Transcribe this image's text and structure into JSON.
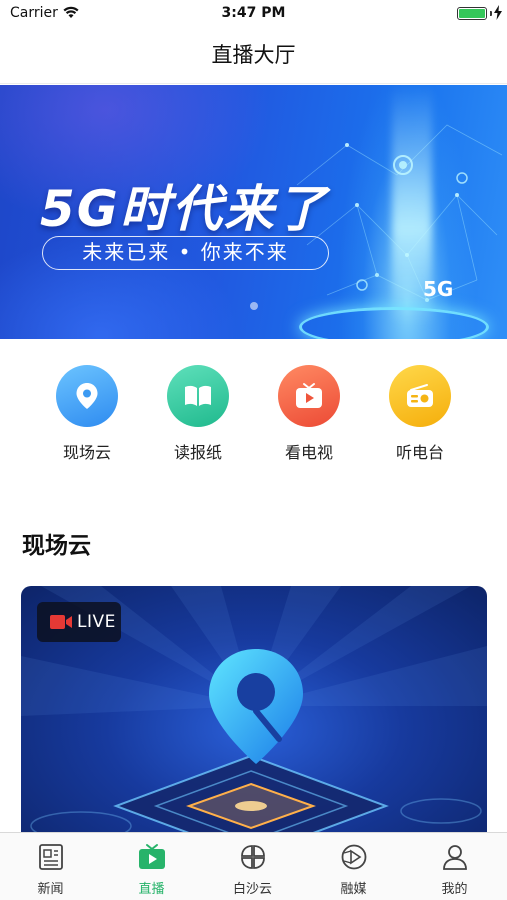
{
  "status_bar": {
    "carrier": "Carrier",
    "time": "3:47 PM",
    "battery_level": 1.0
  },
  "nav": {
    "title": "直播大厅"
  },
  "banner": {
    "headline": "5G时代来了",
    "subtitle": "未来已来 • 你来不来",
    "badge": "5G"
  },
  "quick_links": [
    {
      "label": "现场云",
      "icon": "location-pin-icon",
      "color": "#4aa8f5"
    },
    {
      "label": "读报纸",
      "icon": "book-icon",
      "color": "#33cfa3"
    },
    {
      "label": "看电视",
      "icon": "tv-play-icon",
      "color": "#f4664a"
    },
    {
      "label": "听电台",
      "icon": "radio-icon",
      "color": "#f7c21e"
    }
  ],
  "section": {
    "title": "现场云"
  },
  "live_card": {
    "badge": "LIVE"
  },
  "tabs": [
    {
      "label": "新闻",
      "icon": "news-icon",
      "active": false
    },
    {
      "label": "直播",
      "icon": "live-tv-icon",
      "active": true
    },
    {
      "label": "白沙云",
      "icon": "cloud-grid-icon",
      "active": false
    },
    {
      "label": "融媒",
      "icon": "media-play-icon",
      "active": false
    },
    {
      "label": "我的",
      "icon": "user-icon",
      "active": false
    }
  ],
  "colors": {
    "accent_green": "#27b36a",
    "tab_inactive": "#333333"
  }
}
